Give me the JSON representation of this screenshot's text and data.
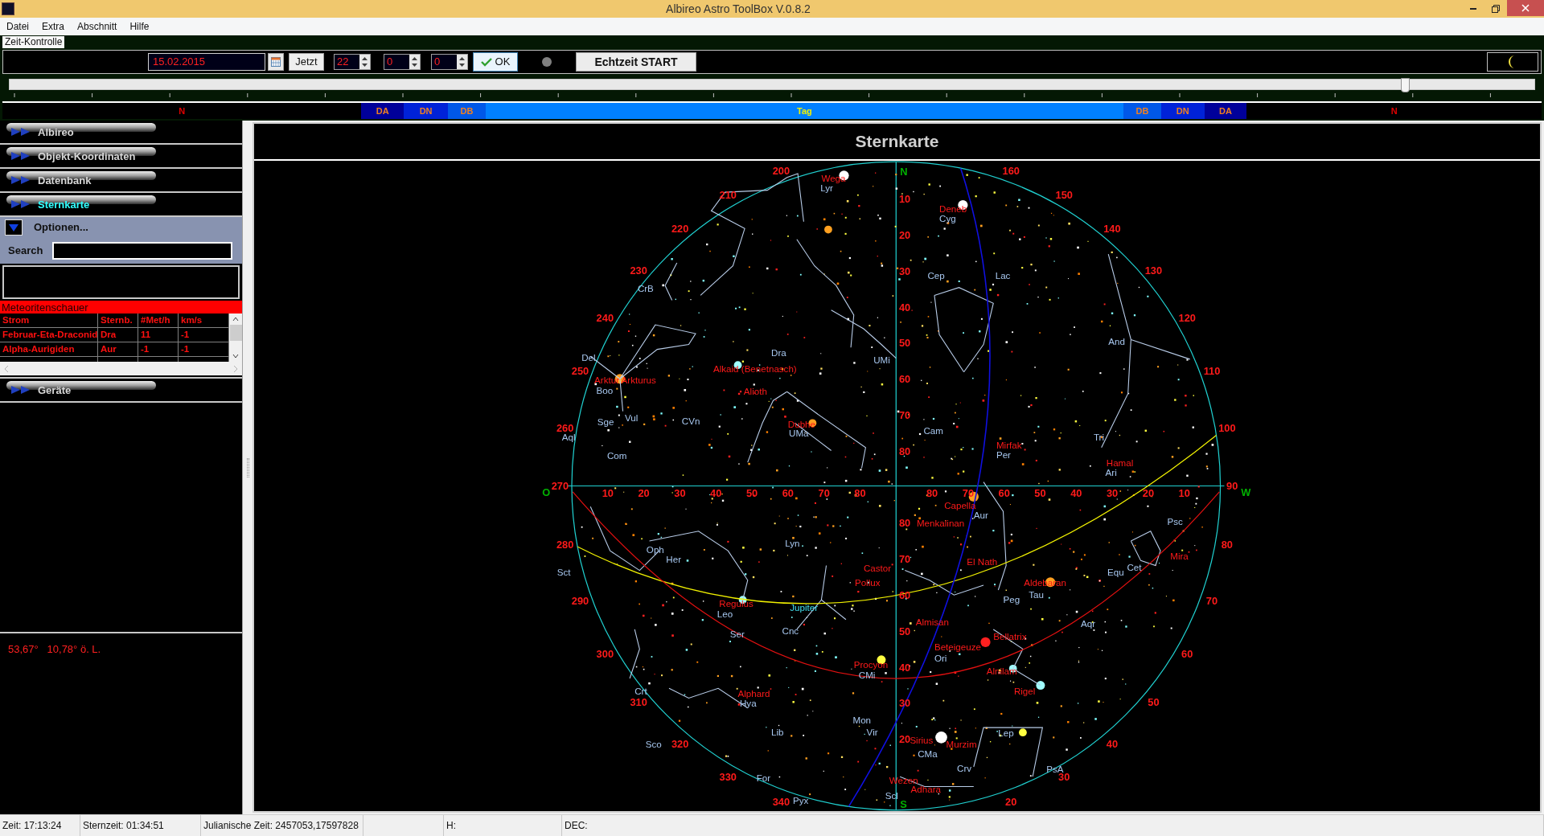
{
  "window": {
    "title": "Albireo Astro ToolBox V.0.8.2"
  },
  "menu": [
    "Datei",
    "Extra",
    "Abschnitt",
    "Hilfe"
  ],
  "time_control": {
    "title": "Zeit-Kontrolle",
    "date": "15.02.2015",
    "now_button": "Jetzt",
    "hour": "22",
    "minute": "0",
    "second": "0",
    "ok_button": "OK",
    "realtime_button": "Echtzeit START",
    "slider": {
      "level": 0.915
    },
    "day_phases": [
      {
        "label": "N",
        "kind": "night"
      },
      {
        "label": "DA",
        "kind": "astronomical"
      },
      {
        "label": "DN",
        "kind": "nautical"
      },
      {
        "label": "DB",
        "kind": "civil"
      },
      {
        "label": "Tag",
        "kind": "day"
      },
      {
        "label": "DB",
        "kind": "civil"
      },
      {
        "label": "DN",
        "kind": "nautical"
      },
      {
        "label": "DA",
        "kind": "astronomical"
      },
      {
        "label": "N",
        "kind": "night"
      }
    ]
  },
  "sidebar": {
    "sections": [
      {
        "label": "Albireo",
        "selected": false
      },
      {
        "label": "Objekt-Koordinaten",
        "selected": false
      },
      {
        "label": "Datenbank",
        "selected": false
      },
      {
        "label": "Sternkarte",
        "selected": true
      }
    ],
    "options": {
      "label": "Optionen...",
      "expanded": true
    },
    "search": {
      "label": "Search"
    },
    "meteor_showers": {
      "title": "Meteoritenschauer",
      "columns": [
        "Strom",
        "Sternb.",
        "#Met/h",
        "km/s"
      ],
      "rows": [
        [
          "Februar-Eta-Draconid",
          "Dra",
          "11",
          "-1"
        ],
        [
          "Alpha-Aurigiden",
          "Aur",
          "-1",
          "-1"
        ]
      ]
    },
    "devices": {
      "label": "Geräte",
      "selected": false
    },
    "location": "53,67°   10,78° ö. L."
  },
  "star_chart": {
    "title": "Sternkarte",
    "compass": [
      "N",
      "O",
      "W",
      "S"
    ],
    "azimuth_labels": [
      "160",
      "150",
      "140",
      "130",
      "120",
      "110",
      "100",
      "90",
      "80",
      "70",
      "60",
      "50",
      "40",
      "30",
      "20",
      "200",
      "210",
      "220",
      "230",
      "240",
      "250",
      "260",
      "270",
      "280",
      "290",
      "300",
      "310",
      "320",
      "330",
      "340"
    ],
    "altitude_labels": {
      "north": [
        "10",
        "20",
        "30",
        "40",
        "50",
        "60",
        "70",
        "80"
      ],
      "south": [
        "80",
        "70",
        "60",
        "50",
        "40",
        "30",
        "20"
      ],
      "east": [
        "10",
        "20",
        "30",
        "40",
        "50",
        "60",
        "70",
        "80"
      ],
      "west": [
        "80",
        "70",
        "60",
        "50",
        "40",
        "30",
        "20",
        "10"
      ]
    },
    "labels": [
      {
        "text": "Wega",
        "kind": "star"
      },
      {
        "text": "Lyr",
        "kind": "constellation"
      },
      {
        "text": "Deneb",
        "kind": "star"
      },
      {
        "text": "Cyg",
        "kind": "constellation"
      },
      {
        "text": "CrB",
        "kind": "constellation"
      },
      {
        "text": "Cep",
        "kind": "constellation"
      },
      {
        "text": "Lac",
        "kind": "constellation"
      },
      {
        "text": "Dra",
        "kind": "constellation"
      },
      {
        "text": "UMi",
        "kind": "constellation"
      },
      {
        "text": "And",
        "kind": "constellation"
      },
      {
        "text": "Del",
        "kind": "constellation"
      },
      {
        "text": "Alkaid (Benetnasch)",
        "kind": "star"
      },
      {
        "text": "Arktur Arkturus",
        "kind": "star"
      },
      {
        "text": "Boo",
        "kind": "constellation"
      },
      {
        "text": "Alioth",
        "kind": "star"
      },
      {
        "text": "Sge",
        "kind": "constellation"
      },
      {
        "text": "Vul",
        "kind": "constellation"
      },
      {
        "text": "CVn",
        "kind": "constellation"
      },
      {
        "text": "Dubhe",
        "kind": "star"
      },
      {
        "text": "UMa",
        "kind": "constellation"
      },
      {
        "text": "Cam",
        "kind": "constellation"
      },
      {
        "text": "Aql",
        "kind": "constellation"
      },
      {
        "text": "Mirfak",
        "kind": "star"
      },
      {
        "text": "Per",
        "kind": "constellation"
      },
      {
        "text": "Tri",
        "kind": "constellation"
      },
      {
        "text": "Com",
        "kind": "constellation"
      },
      {
        "text": "Hamal",
        "kind": "star"
      },
      {
        "text": "Ari",
        "kind": "constellation"
      },
      {
        "text": "Capella",
        "kind": "star"
      },
      {
        "text": "Aur",
        "kind": "constellation"
      },
      {
        "text": "Menkalinan",
        "kind": "star"
      },
      {
        "text": "Psc",
        "kind": "constellation"
      },
      {
        "text": "Oph",
        "kind": "constellation"
      },
      {
        "text": "Lyn",
        "kind": "constellation"
      },
      {
        "text": "Her",
        "kind": "constellation"
      },
      {
        "text": "Mira",
        "kind": "star"
      },
      {
        "text": "El Nath",
        "kind": "star"
      },
      {
        "text": "Castor",
        "kind": "star"
      },
      {
        "text": "Equ",
        "kind": "constellation"
      },
      {
        "text": "Cet",
        "kind": "constellation"
      },
      {
        "text": "Sct",
        "kind": "constellation"
      },
      {
        "text": "Pollux",
        "kind": "star"
      },
      {
        "text": "Aldebaran",
        "kind": "star"
      },
      {
        "text": "Tau",
        "kind": "constellation"
      },
      {
        "text": "Peg",
        "kind": "constellation"
      },
      {
        "text": "Regulus",
        "kind": "star"
      },
      {
        "text": "Jupiter",
        "kind": "planet"
      },
      {
        "text": "Leo",
        "kind": "constellation"
      },
      {
        "text": "Almisan",
        "kind": "star"
      },
      {
        "text": "Aqr",
        "kind": "constellation"
      },
      {
        "text": "Ser",
        "kind": "constellation"
      },
      {
        "text": "Cnc",
        "kind": "constellation"
      },
      {
        "text": "Bellatrix",
        "kind": "star"
      },
      {
        "text": "Beteigeuze",
        "kind": "star"
      },
      {
        "text": "Ori",
        "kind": "constellation"
      },
      {
        "text": "Procyon",
        "kind": "star"
      },
      {
        "text": "CMi",
        "kind": "constellation"
      },
      {
        "text": "Alnilam",
        "kind": "star"
      },
      {
        "text": "Crt",
        "kind": "constellation"
      },
      {
        "text": "Alphard",
        "kind": "star"
      },
      {
        "text": "Rigel",
        "kind": "star"
      },
      {
        "text": "Hya",
        "kind": "constellation"
      },
      {
        "text": "Mon",
        "kind": "constellation"
      },
      {
        "text": "Lib",
        "kind": "constellation"
      },
      {
        "text": "Vir",
        "kind": "constellation"
      },
      {
        "text": "Lep",
        "kind": "constellation"
      },
      {
        "text": "Sco",
        "kind": "constellation"
      },
      {
        "text": "Sirius",
        "kind": "star"
      },
      {
        "text": "Murzim",
        "kind": "star"
      },
      {
        "text": "CMa",
        "kind": "constellation"
      },
      {
        "text": "Crv",
        "kind": "constellation"
      },
      {
        "text": "PsA",
        "kind": "constellation"
      },
      {
        "text": "For",
        "kind": "constellation"
      },
      {
        "text": "Wezen",
        "kind": "star"
      },
      {
        "text": "Adhara",
        "kind": "star"
      },
      {
        "text": "Scl",
        "kind": "constellation"
      },
      {
        "text": "Pyx",
        "kind": "constellation"
      }
    ]
  },
  "status_bar": [
    "Zeit: 17:13:24",
    "Sternzeit: 01:34:51",
    "Julianische Zeit: 2457053,17597828",
    "H:",
    "DEC:"
  ]
}
